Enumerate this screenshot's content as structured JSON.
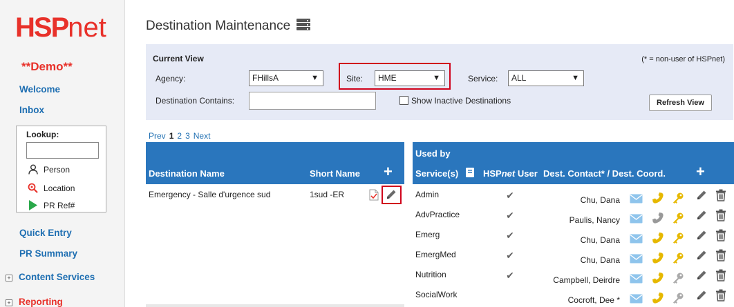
{
  "sidebar": {
    "logo_hsp": "HSP",
    "logo_net": "net",
    "demo": "**Demo**",
    "welcome": "Welcome",
    "inbox": "Inbox",
    "lookup": {
      "label": "Lookup:",
      "items": [
        "Person",
        "Location",
        "PR Ref#"
      ]
    },
    "quick_entry": "Quick Entry",
    "pr_summary": "PR Summary",
    "content_services": "Content Services",
    "reporting": "Reporting",
    "expand_symbol": "+"
  },
  "header": {
    "title": "Destination Maintenance"
  },
  "view": {
    "title": "Current View",
    "note": "(* = non-user of HSPnet)",
    "agency_label": "Agency:",
    "agency_value": "FHillsA",
    "site_label": "Site:",
    "site_value": "HME",
    "service_label": "Service:",
    "service_value": "ALL",
    "dest_contains_label": "Destination Contains:",
    "dest_contains_value": "",
    "show_inactive_label": "Show Inactive Destinations",
    "refresh_label": "Refresh View",
    "arrow": "▼"
  },
  "pager": {
    "prev": "Prev",
    "pages": [
      "1",
      "2",
      "3"
    ],
    "current": "1",
    "next": "Next"
  },
  "dest_table": {
    "col_name": "Destination Name",
    "col_short": "Short Name",
    "add": "+",
    "rows": [
      {
        "name": "Emergency - Salle d'urgence sud",
        "short": "1sud -ER"
      }
    ]
  },
  "service_table": {
    "col_used_by": "Used by",
    "col_services": "Service(s)",
    "col_hspnet_user": "HSPnet User",
    "col_hspnet_user_pre": "HSP",
    "col_hspnet_user_em": "net",
    "col_hspnet_user_post": " User",
    "col_contact": "Dest. Contact* / Dest. Coord.",
    "add": "+",
    "rows": [
      {
        "service": "Admin",
        "user": true,
        "contact": "Chu, Dana",
        "phone_active": true,
        "key_active": true
      },
      {
        "service": "AdvPractice",
        "user": true,
        "contact": "Paulis, Nancy",
        "phone_active": false,
        "key_active": true
      },
      {
        "service": "Emerg",
        "user": true,
        "contact": "Chu, Dana",
        "phone_active": true,
        "key_active": true
      },
      {
        "service": "EmergMed",
        "user": true,
        "contact": "Chu, Dana",
        "phone_active": true,
        "key_active": true
      },
      {
        "service": "Nutrition",
        "user": true,
        "contact": "Campbell, Deirdre",
        "phone_active": true,
        "key_active": false
      },
      {
        "service": "SocialWork",
        "user": false,
        "contact": "Cocroft, Dee *",
        "phone_active": true,
        "key_active": false
      }
    ]
  },
  "colors": {
    "brand_red": "#e8312a",
    "link_blue": "#1f6fb2",
    "header_blue": "#2a76bd",
    "panel_bg": "#e6eaf6",
    "highlight_red": "#d0021b",
    "phone_yellow": "#e6b800",
    "mail_blue": "#8ec4ec"
  }
}
